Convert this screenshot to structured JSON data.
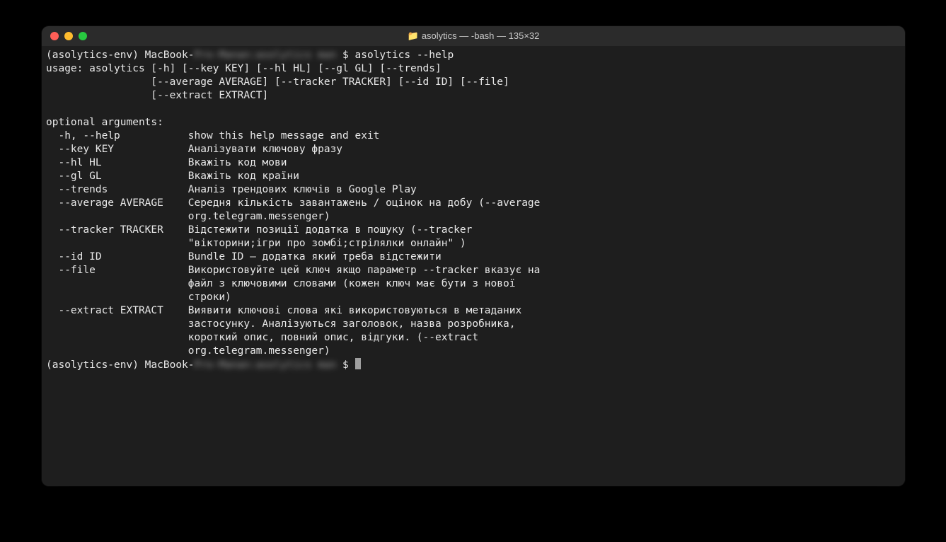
{
  "title": {
    "folder_icon": "📁",
    "text": "asolytics — -bash — 135×32"
  },
  "traffic": {
    "close": "close",
    "minimize": "minimize",
    "zoom": "zoom"
  },
  "terminal": {
    "prompt1_env": "(asolytics-env) MacBook-",
    "prompt1_blur": "Pro-Manan:asolytics man",
    "prompt1_end": " $ ",
    "command": "asolytics --help",
    "usage_line1": "usage: asolytics [-h] [--key KEY] [--hl HL] [--gl GL] [--trends]",
    "usage_line2": "                 [--average AVERAGE] [--tracker TRACKER] [--id ID] [--file]",
    "usage_line3": "                 [--extract EXTRACT]",
    "opt_header": "optional arguments:",
    "opt_help": "  -h, --help           show this help message and exit",
    "opt_key": "  --key KEY            Аналізувати ключову фразу",
    "opt_hl": "  --hl HL              Вкажіть код мови",
    "opt_gl": "  --gl GL              Вкажіть код країни",
    "opt_trends": "  --trends             Аналіз трендових ключів в Google Play",
    "opt_avg1": "  --average AVERAGE    Середня кількість завантажень / оцінок на добу (--average",
    "opt_avg2": "                       org.telegram.messenger)",
    "opt_trk1": "  --tracker TRACKER    Відстежити позиції додатка в пошуку (--tracker",
    "opt_trk2": "                       \"вікторини;ігри про зомбі;стрілялки онлайн\" )",
    "opt_id": "  --id ID              Bundle ID – додатка який треба відстежити",
    "opt_file1": "  --file               Використовуйте цей ключ якщо параметр --tracker вказує на",
    "opt_file2": "                       файл з ключовими словами (кожен ключ має бути з нової",
    "opt_file3": "                       строки)",
    "opt_ext1": "  --extract EXTRACT    Виявити ключові слова які використовуються в метаданих",
    "opt_ext2": "                       застосунку. Аналізуються заголовок, назва розробника,",
    "opt_ext3": "                       короткий опис, повний опис, відгуки. (--extract",
    "opt_ext4": "                       org.telegram.messenger)",
    "prompt2_env": "(asolytics-env) MacBook-",
    "prompt2_blur": "Pro-Manan:asolytics man",
    "prompt2_end": " $ "
  }
}
